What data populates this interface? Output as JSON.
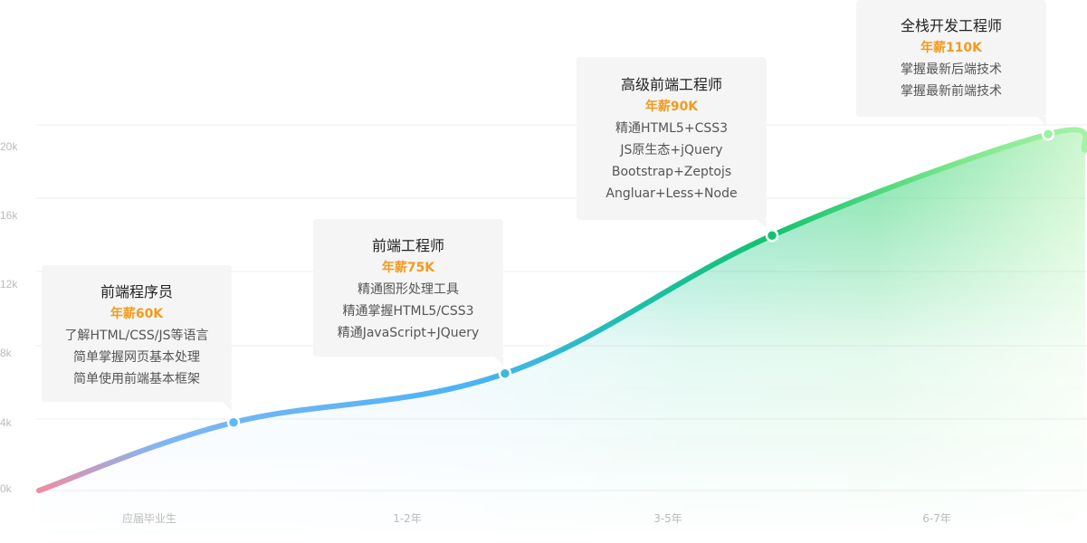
{
  "chart_data": {
    "type": "area",
    "y_ticks": [
      "0k",
      "4k",
      "8k",
      "12k",
      "16k",
      "20k"
    ],
    "ylim": [
      0,
      20
    ],
    "categories": [
      "应届毕业生",
      "1-2年",
      "3-5年",
      "6-7年"
    ],
    "points": [
      {
        "x": 0.0,
        "y": 0.0
      },
      {
        "x": 1.0,
        "y": 3.9
      },
      {
        "x": 2.0,
        "y": 6.7
      },
      {
        "x": 3.0,
        "y": 14.6
      },
      {
        "x": 4.0,
        "y": 20.4
      }
    ],
    "cards": [
      {
        "title": "前端程序员",
        "salary": "年薪60K",
        "skills": [
          "了解HTML/CSS/JS等语言",
          "简单掌握网页基本处理",
          "简单使用前端基本框架"
        ]
      },
      {
        "title": "前端工程师",
        "salary": "年薪75K",
        "skills": [
          "精通图形处理工具",
          "精通掌握HTML5/CSS3",
          "精通JavaScript+JQuery"
        ]
      },
      {
        "title": "高级前端工程师",
        "salary": "年薪90K",
        "skills": [
          "精通HTML5+CSS3",
          "JS原生态+jQuery",
          "Bootstrap+Zeptojs",
          "Angluar+Less+Node"
        ]
      },
      {
        "title": "全栈开发工程师",
        "salary": "年薪110K",
        "skills": [
          "掌握最新后端技术",
          "掌握最新前端技术"
        ]
      }
    ]
  },
  "colors": {
    "curve_start": "#f28ca0",
    "curve_blue": "#4ab3f5",
    "curve_green": "#13c26f",
    "curve_end": "#a6f2a6",
    "salary": "#f39a1e",
    "card_bg": "#f5f5f5",
    "grid": "#eeeeee",
    "tick": "#bbbbbb"
  }
}
